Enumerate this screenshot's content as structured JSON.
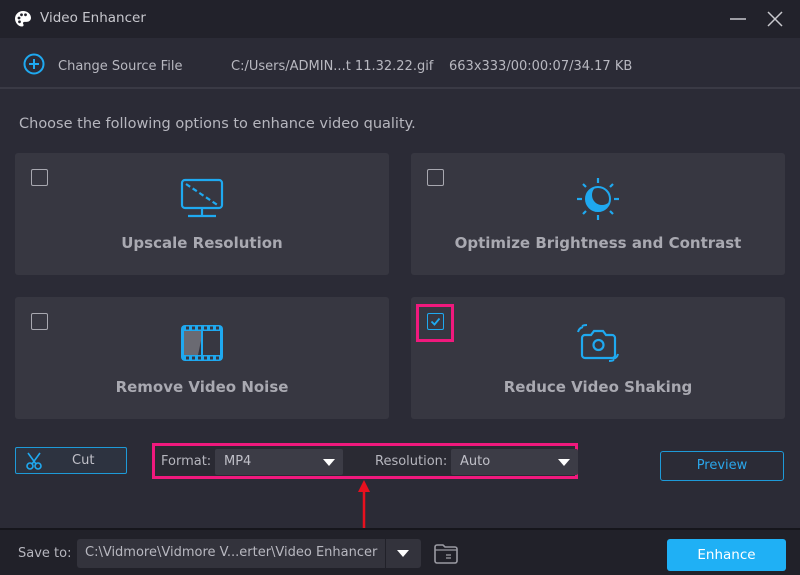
{
  "window": {
    "title": "Video Enhancer",
    "icons": {
      "app": "palette-icon",
      "minimize": "minimize-icon",
      "close": "close-icon"
    }
  },
  "source": {
    "change_label": "Change Source File",
    "file_path": "C:/Users/ADMIN...t 11.32.22.gif",
    "file_info": "663x333/00:00:07/34.17 KB",
    "icon": "plus-circle-icon"
  },
  "intro_text": "Choose the following options to enhance video quality.",
  "options": [
    {
      "label": "Upscale Resolution",
      "icon": "monitor-icon",
      "checked": false
    },
    {
      "label": "Optimize Brightness and Contrast",
      "icon": "brightness-icon",
      "checked": false
    },
    {
      "label": "Remove Video Noise",
      "icon": "film-noise-icon",
      "checked": false
    },
    {
      "label": "Reduce Video Shaking",
      "icon": "camera-shake-icon",
      "checked": true,
      "highlighted": true
    }
  ],
  "toolbar": {
    "cut_label": "Cut",
    "format_label": "Format:",
    "format_value": "MP4",
    "resolution_label": "Resolution:",
    "resolution_value": "Auto",
    "preview_label": "Preview"
  },
  "annotations": {
    "highlight_color": "#f0197d",
    "arrow_color": "#e8101e"
  },
  "footer": {
    "save_label": "Save to:",
    "save_path": "C:\\Vidmore\\Vidmore V...erter\\Video Enhancer",
    "enhance_label": "Enhance"
  },
  "colors": {
    "accent": "#1fb0f5",
    "background": "#2b2b36",
    "card": "#373741"
  }
}
